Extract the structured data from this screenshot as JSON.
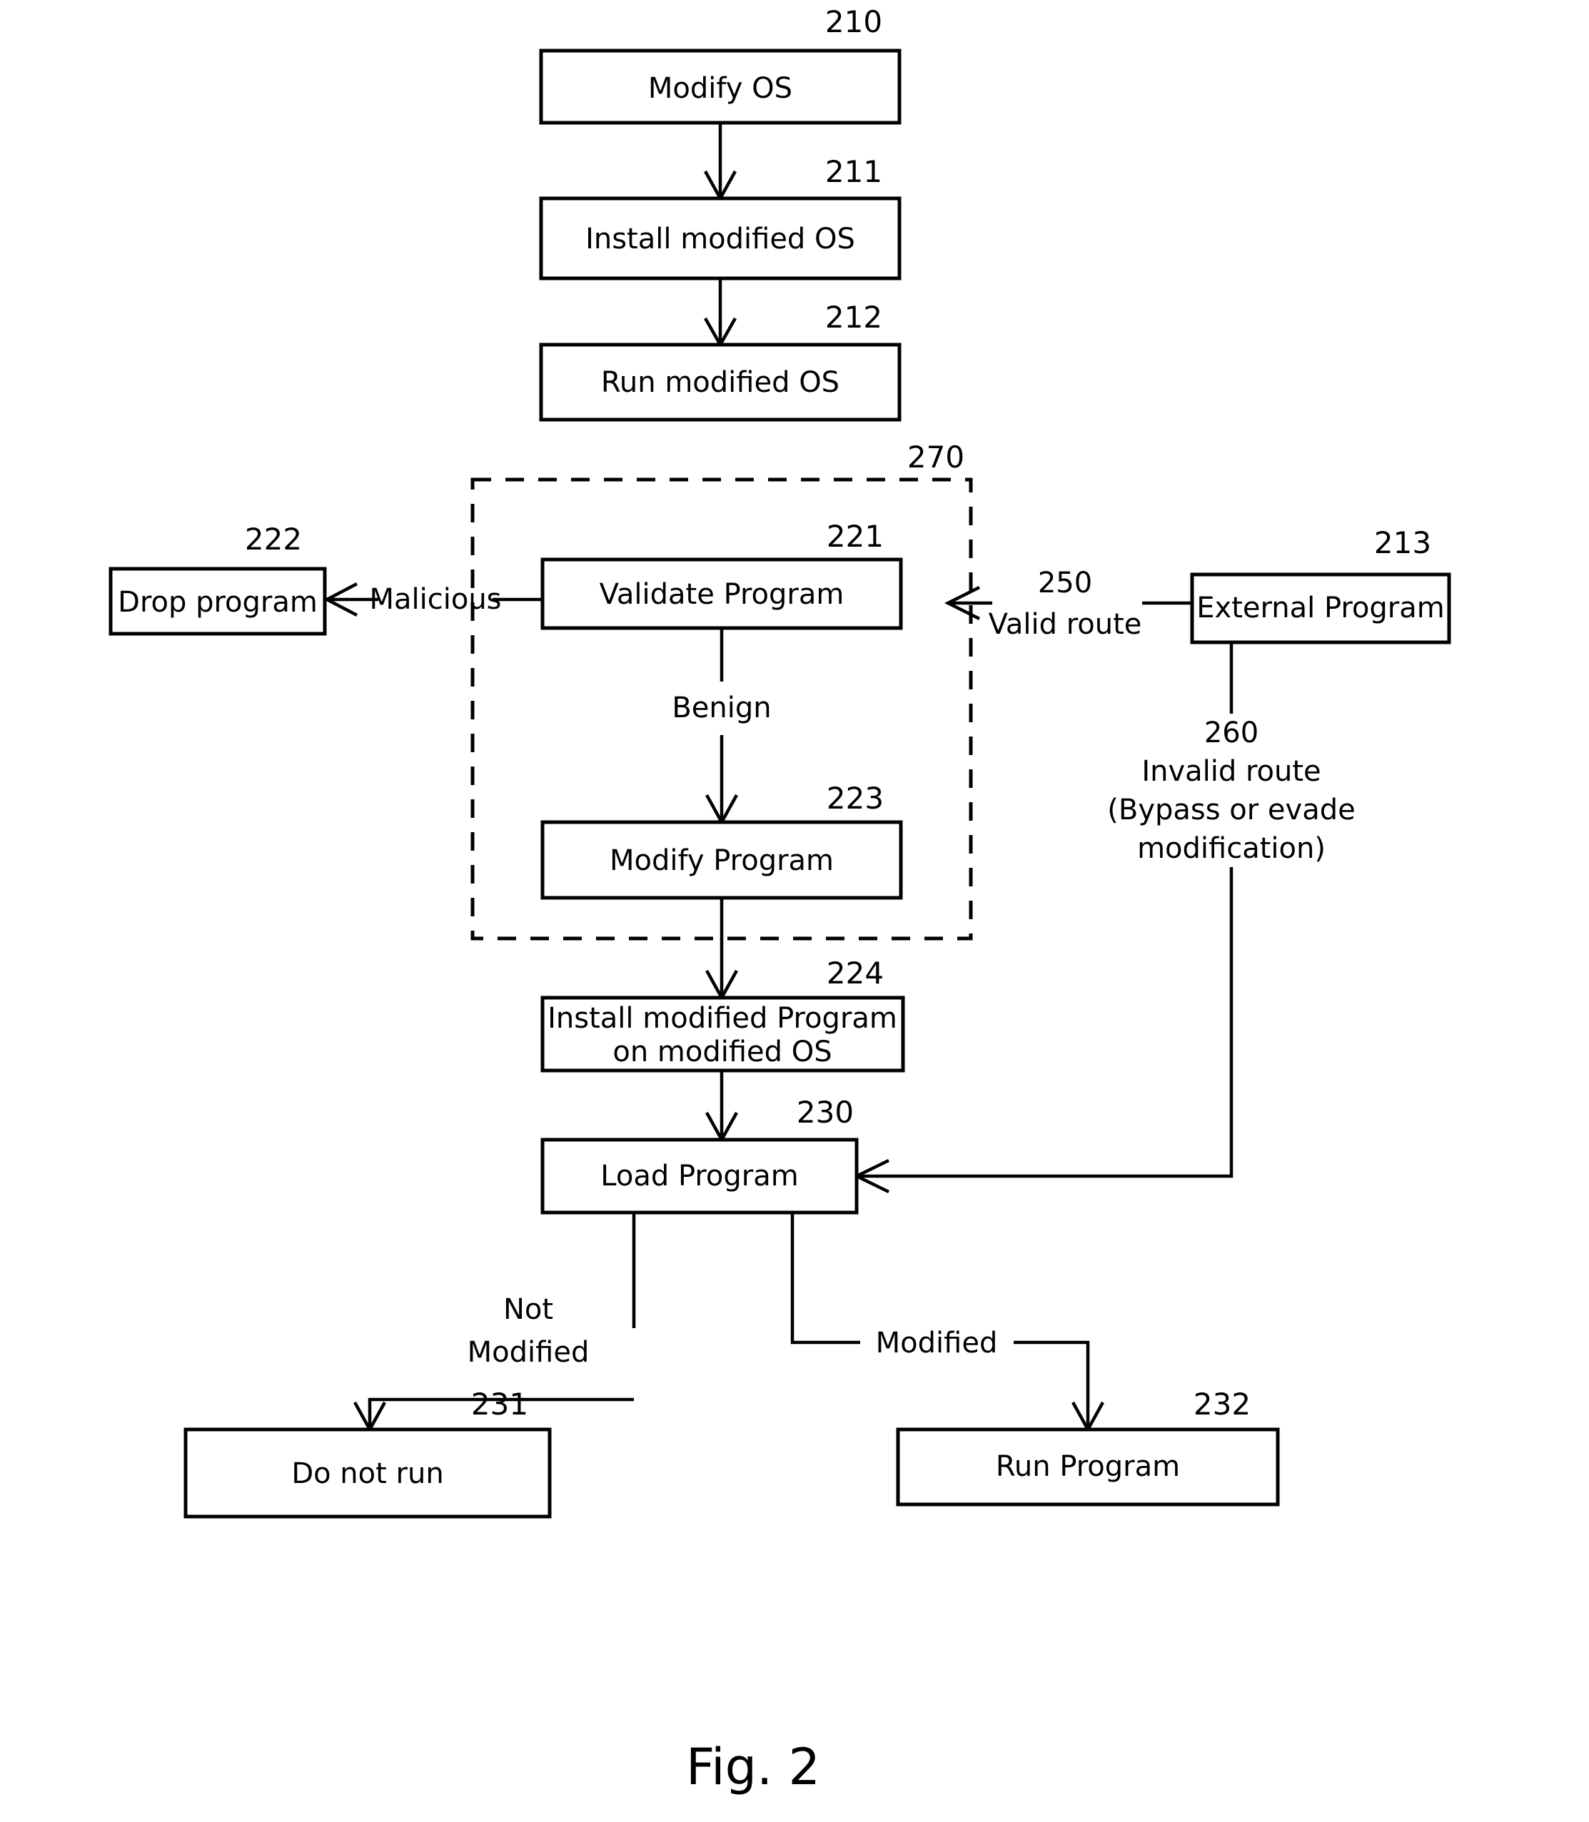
{
  "figure": {
    "caption": "Fig. 2",
    "boxes": {
      "b210": {
        "ref": "210",
        "label": "Modify OS"
      },
      "b211": {
        "ref": "211",
        "label": "Install modified OS"
      },
      "b212": {
        "ref": "212",
        "label": "Run modified OS"
      },
      "b221": {
        "ref": "221",
        "label": "Validate Program"
      },
      "b222": {
        "ref": "222",
        "label": "Drop program"
      },
      "b223": {
        "ref": "223",
        "label": "Modify Program"
      },
      "b224": {
        "ref": "224",
        "label_line1": "Install modified Program",
        "label_line2": "on modified OS"
      },
      "b213": {
        "ref": "213",
        "label": "External Program"
      },
      "b230": {
        "ref": "230",
        "label": "Load Program"
      },
      "b231": {
        "ref": "231",
        "label": "Do not run"
      },
      "b232": {
        "ref": "232",
        "label": "Run Program"
      }
    },
    "group": {
      "ref": "270"
    },
    "edge_labels": {
      "malicious": "Malicious",
      "benign": "Benign",
      "not_modified_line1": "Not",
      "not_modified_line2": "Modified",
      "modified": "Modified"
    },
    "routes": {
      "valid": {
        "ref": "250",
        "label": "Valid route"
      },
      "invalid": {
        "ref": "260",
        "label_line1": "Invalid route",
        "label_line2": "(Bypass or evade",
        "label_line3": "modification)"
      }
    },
    "colors": {
      "ink": "#000000",
      "paper": "#ffffff"
    }
  }
}
